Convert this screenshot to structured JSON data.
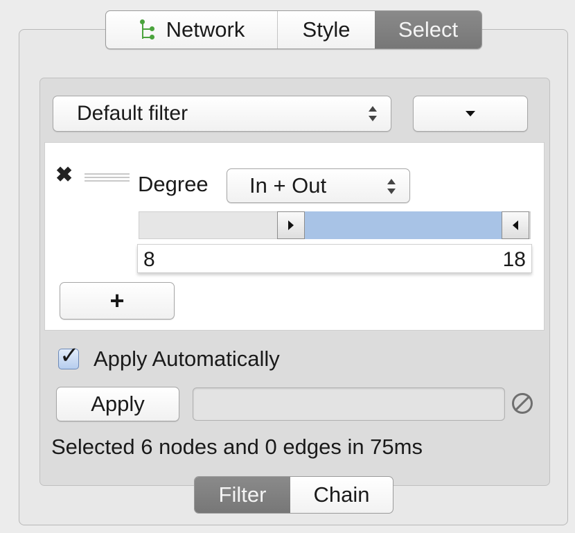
{
  "tabs": {
    "network": "Network",
    "style": "Style",
    "select": "Select",
    "active": "Select",
    "network_icon": "network-tree-icon"
  },
  "filter": {
    "selected_filter": "Default filter",
    "menu_icon": "triangle-down-icon"
  },
  "criteria": {
    "remove_icon": "close-icon",
    "drag_icon": "drag-handle-icon",
    "label": "Degree",
    "mode": "In + Out",
    "range_low": "8",
    "range_high": "18"
  },
  "add_button": "+",
  "apply_automatically": {
    "label": "Apply Automatically",
    "checked": true
  },
  "apply_button": "Apply",
  "cancel_icon": "cancel-icon",
  "status": "Selected 6 nodes and 0 edges in 75ms",
  "bottom_tabs": {
    "filter": "Filter",
    "chain": "Chain",
    "active": "Filter"
  },
  "colors": {
    "range_fill": "#a8c3e6",
    "active_tab": "#808080",
    "network_icon": "#4aa33c"
  }
}
